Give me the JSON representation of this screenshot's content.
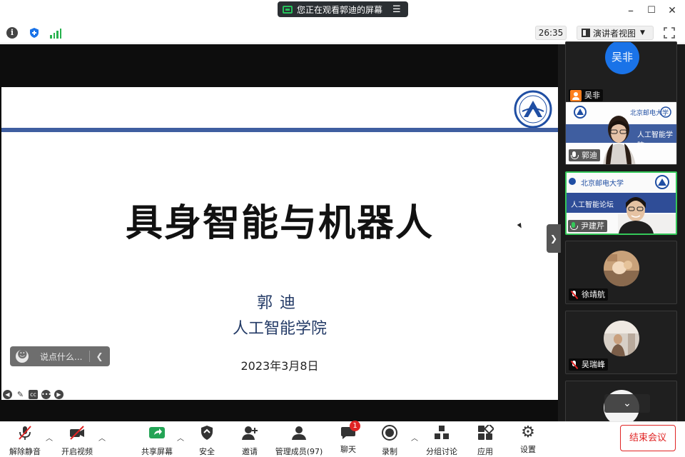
{
  "titlebar": {
    "share_notice": "您正在观看郭迪的屏幕",
    "menu_glyph": "☰",
    "minimize": "–",
    "maximize": "☐",
    "close": "✕"
  },
  "infobar": {
    "timer": "26:35",
    "view_mode": "演讲者视图"
  },
  "slide": {
    "title": "具身智能与机器人",
    "author": "郭迪",
    "department": "人工智能学院",
    "date": "2023年3月8日"
  },
  "reactions": {
    "say_placeholder": "说点什么..."
  },
  "gallery": {
    "participants": [
      {
        "name": "吴非",
        "avatar_text": "吴非",
        "audio": "none"
      },
      {
        "name": "郭迪",
        "audio": "unmuted",
        "banner": "人工智能学院"
      },
      {
        "name": "尹建芹",
        "audio": "speaking",
        "banner": "人工智能论坛",
        "logo_text": "北京邮电大学"
      },
      {
        "name": "徐靖航",
        "audio": "muted"
      },
      {
        "name": "吴瑞峰",
        "audio": "muted"
      }
    ]
  },
  "toolbar": {
    "unmute": "解除静音",
    "start_video": "开启视频",
    "share_screen": "共享屏幕",
    "security": "安全",
    "invite": "邀请",
    "participants": "管理成员(97)",
    "chat": "聊天",
    "chat_badge": "1",
    "record": "录制",
    "breakout": "分组讨论",
    "apps": "应用",
    "settings": "设置",
    "end_meeting": "结束会议"
  },
  "colors": {
    "accent_blue": "#3f5ea0",
    "speaking_green": "#34c759",
    "danger_red": "#e02424",
    "avatar_blue": "#1a73e8"
  }
}
